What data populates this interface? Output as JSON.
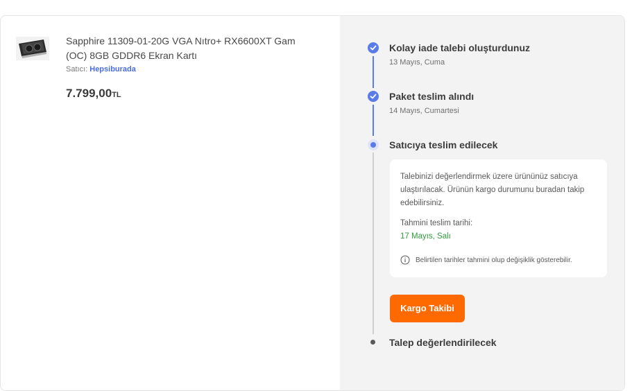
{
  "product": {
    "title": "Sapphire 11309-01-20G VGA Nıtro+ RX6600XT Gam (OC) 8GB GDDR6 Ekran Kartı",
    "seller_label": "Satıcı:",
    "seller_name": "Hepsiburada",
    "price": "7.799,00",
    "currency": "TL"
  },
  "timeline": {
    "steps": [
      {
        "title": "Kolay iade talebi oluşturdunuz",
        "date": "13 Mayıs, Cuma",
        "state": "done"
      },
      {
        "title": "Paket teslim alındı",
        "date": "14 Mayıs, Cumartesi",
        "state": "done"
      },
      {
        "title": "Satıcıya teslim edilecek",
        "state": "active"
      },
      {
        "title": "Talep değerlendirilecek",
        "state": "pending"
      }
    ],
    "info": {
      "text": "Talebinizi değerlendirmek üzere ürününüz satıcıya ulaştırılacak. Ürünün kargo durumunu buradan takip edebilirsiniz.",
      "estimate_label": "Tahmini teslim tarihi:",
      "estimate_date": "17 Mayıs, Salı",
      "note": "Belirtilen tarihler tahmini olup değişiklik gösterebilir."
    },
    "tracking_button": "Kargo Takibi"
  },
  "colors": {
    "accent": "#5b7be9",
    "button": "#ff6a00",
    "success": "#2f9a3b"
  },
  "icons": [
    "product-thumbnail-image",
    "check-icon",
    "info-icon"
  ]
}
